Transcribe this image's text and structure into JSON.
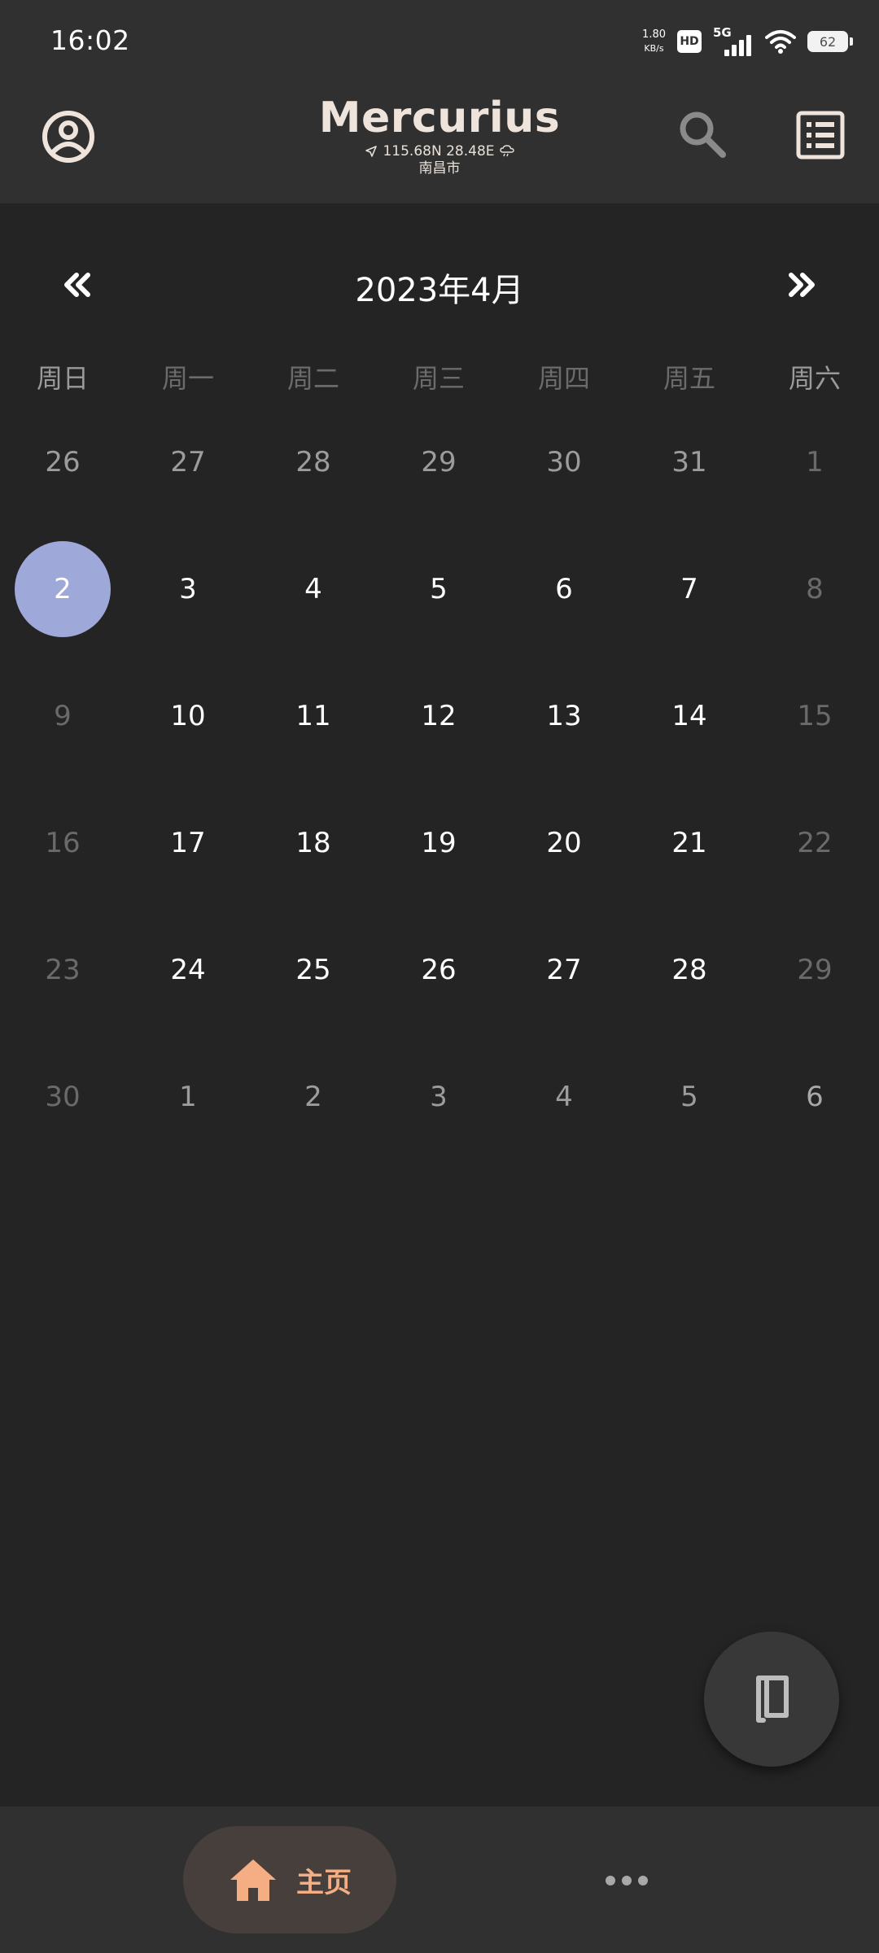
{
  "status_bar": {
    "time": "16:02",
    "net_speed_value": "1.80",
    "net_speed_unit": "KB/s",
    "hd_label": "HD",
    "network_label": "5G",
    "battery_level": "62"
  },
  "app_bar": {
    "title": "Mercurius",
    "coordinates": "115.68N 28.48E",
    "city": "南昌市",
    "icons": [
      "account-circle-icon",
      "location-arrow-icon",
      "weather-icon",
      "search-icon",
      "list-icon"
    ]
  },
  "calendar": {
    "month_title": "2023年4月",
    "weekdays": [
      "周日",
      "周一",
      "周二",
      "周三",
      "周四",
      "周五",
      "周六"
    ],
    "weeks": [
      [
        "26",
        "27",
        "28",
        "29",
        "30",
        "31",
        "1"
      ],
      [
        "2",
        "3",
        "4",
        "5",
        "6",
        "7",
        "8"
      ],
      [
        "9",
        "10",
        "11",
        "12",
        "13",
        "14",
        "15"
      ],
      [
        "16",
        "17",
        "18",
        "19",
        "20",
        "21",
        "22"
      ],
      [
        "23",
        "24",
        "25",
        "26",
        "27",
        "28",
        "29"
      ],
      [
        "30",
        "1",
        "2",
        "3",
        "4",
        "5",
        "6"
      ]
    ],
    "selected_day": "2"
  },
  "fab": {
    "icon": "notebook-icon"
  },
  "bottom_nav": {
    "home_label": "主页",
    "home_icon": "home-icon",
    "more_icon": "more-dots-icon",
    "accent_color": "#f5ae84"
  },
  "colors": {
    "background": "#242424",
    "bar": "#303030",
    "selected_day": "#9ea8d9"
  }
}
